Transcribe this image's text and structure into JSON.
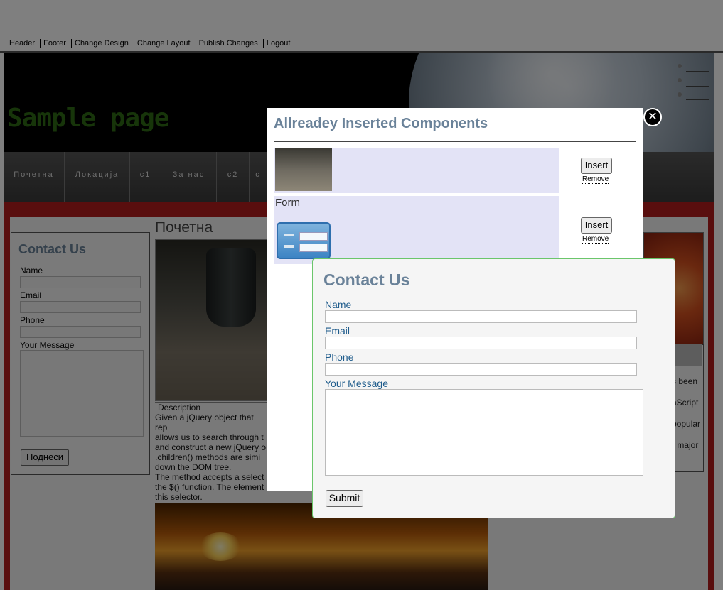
{
  "topnav": {
    "items": [
      "Header",
      "Footer",
      "Change Design",
      "Change Layout",
      "Publish Changes",
      "Logout"
    ]
  },
  "site": {
    "title": "Sample page"
  },
  "nav": {
    "items": [
      "Почетна",
      "Локација",
      "c1",
      "За нас",
      "c2",
      "c"
    ]
  },
  "left_contact": {
    "title": "Contact Us",
    "name_label": "Name",
    "email_label": "Email",
    "phone_label": "Phone",
    "message_label": "Your Message",
    "submit_label": "Поднеси"
  },
  "main": {
    "title": "Почетна",
    "description_heading": "Description",
    "description_lines": [
      "Given a jQuery object that rep",
      "allows us to search through t",
      "and construct a new jQuery o",
      ".children() methods are simi",
      "down the DOM tree.",
      "The method accepts a select",
      "the $() function. The element",
      "this selector."
    ]
  },
  "right_col": {
    "lines": [
      "s been",
      "aScript",
      "popular",
      "r major"
    ]
  },
  "modal": {
    "title": "Allreadey Inserted Components",
    "close_symbol": "✕",
    "components": [
      {
        "label": "",
        "insert_label": "Insert",
        "remove_label": "Remove"
      },
      {
        "label": "Form",
        "insert_label": "Insert",
        "remove_label": "Remove"
      }
    ]
  },
  "contact_popup": {
    "title": "Contact Us",
    "name_label": "Name",
    "email_label": "Email",
    "phone_label": "Phone",
    "message_label": "Your Message",
    "submit_label": "Submit"
  },
  "colors": {
    "accent_title": "#6a8299",
    "site_title": "#2e6a14",
    "content_frame": "#b31c1c",
    "popup_border": "#6bc66b"
  }
}
